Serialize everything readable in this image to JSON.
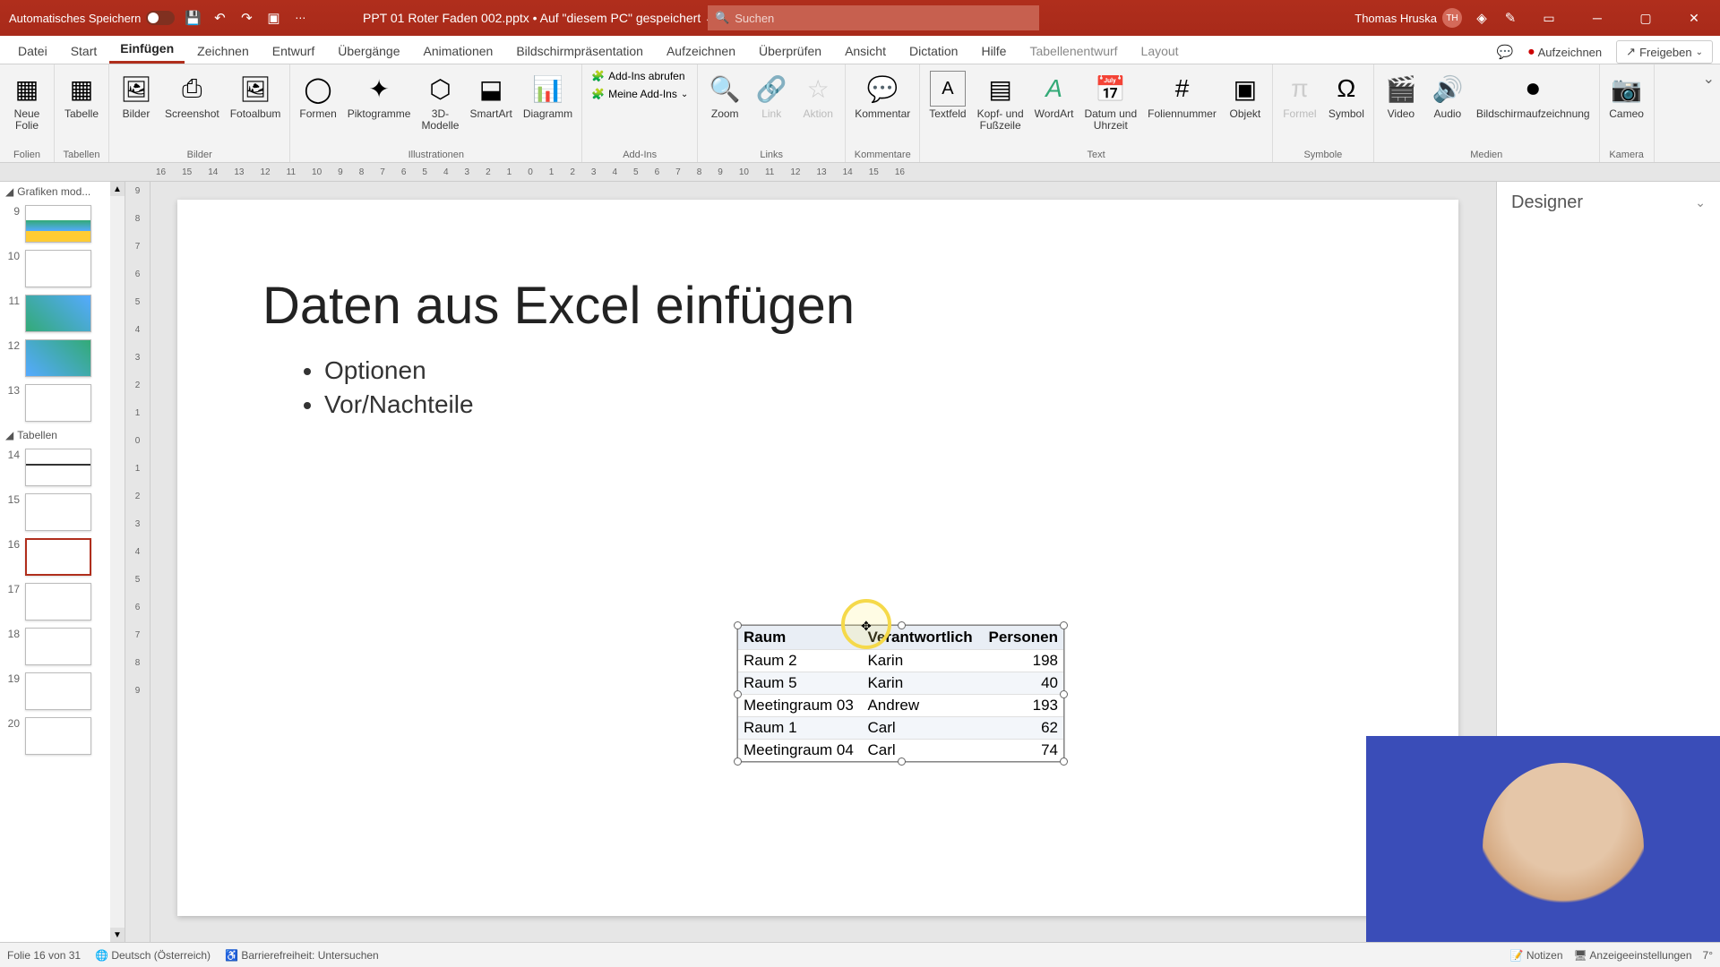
{
  "titlebar": {
    "autosave": "Automatisches Speichern",
    "filename": "PPT 01 Roter Faden 002.pptx • Auf \"diesem PC\" gespeichert ⌄",
    "search_placeholder": "Suchen",
    "user_name": "Thomas Hruska",
    "user_initials": "TH"
  },
  "tabs": {
    "items": [
      "Datei",
      "Start",
      "Einfügen",
      "Zeichnen",
      "Entwurf",
      "Übergänge",
      "Animationen",
      "Bildschirmpräsentation",
      "Aufzeichnen",
      "Überprüfen",
      "Ansicht",
      "Dictation",
      "Hilfe",
      "Tabellenentwurf",
      "Layout"
    ],
    "active": 2,
    "record": "Aufzeichnen",
    "share": "Freigeben"
  },
  "ribbon": {
    "groups": {
      "folien": {
        "label": "Folien",
        "btn_neue": "Neue\nFolie"
      },
      "tabellen": {
        "label": "Tabellen",
        "btn": "Tabelle"
      },
      "bilder": {
        "label": "Bilder",
        "items": [
          "Bilder",
          "Screenshot",
          "Fotoalbum"
        ]
      },
      "illustrationen": {
        "label": "Illustrationen",
        "items": [
          "Formen",
          "Piktogramme",
          "3D-\nModelle",
          "SmartArt",
          "Diagramm"
        ]
      },
      "addins": {
        "label": "Add-Ins",
        "row1": "Add-Ins abrufen",
        "row2": "Meine Add-Ins"
      },
      "links": {
        "label": "Links",
        "items": [
          "Zoom",
          "Link",
          "Aktion"
        ]
      },
      "kommentare": {
        "label": "Kommentare",
        "btn": "Kommentar"
      },
      "text": {
        "label": "Text",
        "items": [
          "Textfeld",
          "Kopf- und\nFußzeile",
          "WordArt",
          "Datum und\nUhrzeit",
          "Foliennummer",
          "Objekt"
        ]
      },
      "symbole": {
        "label": "Symbole",
        "items": [
          "Formel",
          "Symbol"
        ]
      },
      "medien": {
        "label": "Medien",
        "items": [
          "Video",
          "Audio",
          "Bildschirmaufzeichnung"
        ]
      },
      "kamera": {
        "label": "Kamera",
        "btn": "Cameo"
      }
    }
  },
  "thumbs": {
    "header1": "Grafiken mod...",
    "header2": "Tabellen",
    "items": [
      {
        "num": "9"
      },
      {
        "num": "10"
      },
      {
        "num": "11"
      },
      {
        "num": "12"
      },
      {
        "num": "13"
      },
      {
        "num": "14"
      },
      {
        "num": "15"
      },
      {
        "num": "16",
        "active": true
      },
      {
        "num": "17"
      },
      {
        "num": "18"
      },
      {
        "num": "19"
      },
      {
        "num": "20"
      }
    ]
  },
  "slide": {
    "title": "Daten aus Excel einfügen",
    "bullets": [
      "Optionen",
      "Vor/Nachteile"
    ],
    "table": {
      "headers": [
        "Raum",
        "Verantwortlich",
        "Personen"
      ],
      "rows": [
        [
          "Raum 2",
          "Karin",
          "198"
        ],
        [
          "Raum 5",
          "Karin",
          "40"
        ],
        [
          "Meetingraum 03",
          "Andrew",
          "193"
        ],
        [
          "Raum 1",
          "Carl",
          "62"
        ],
        [
          "Meetingraum 04",
          "Carl",
          "74"
        ]
      ]
    }
  },
  "designer": {
    "title": "Designer"
  },
  "status": {
    "slide": "Folie 16 von 31",
    "lang": "Deutsch (Österreich)",
    "access": "Barrierefreiheit: Untersuchen",
    "notes": "Notizen",
    "display": "Anzeigeeinstellungen",
    "temp": "7°"
  }
}
